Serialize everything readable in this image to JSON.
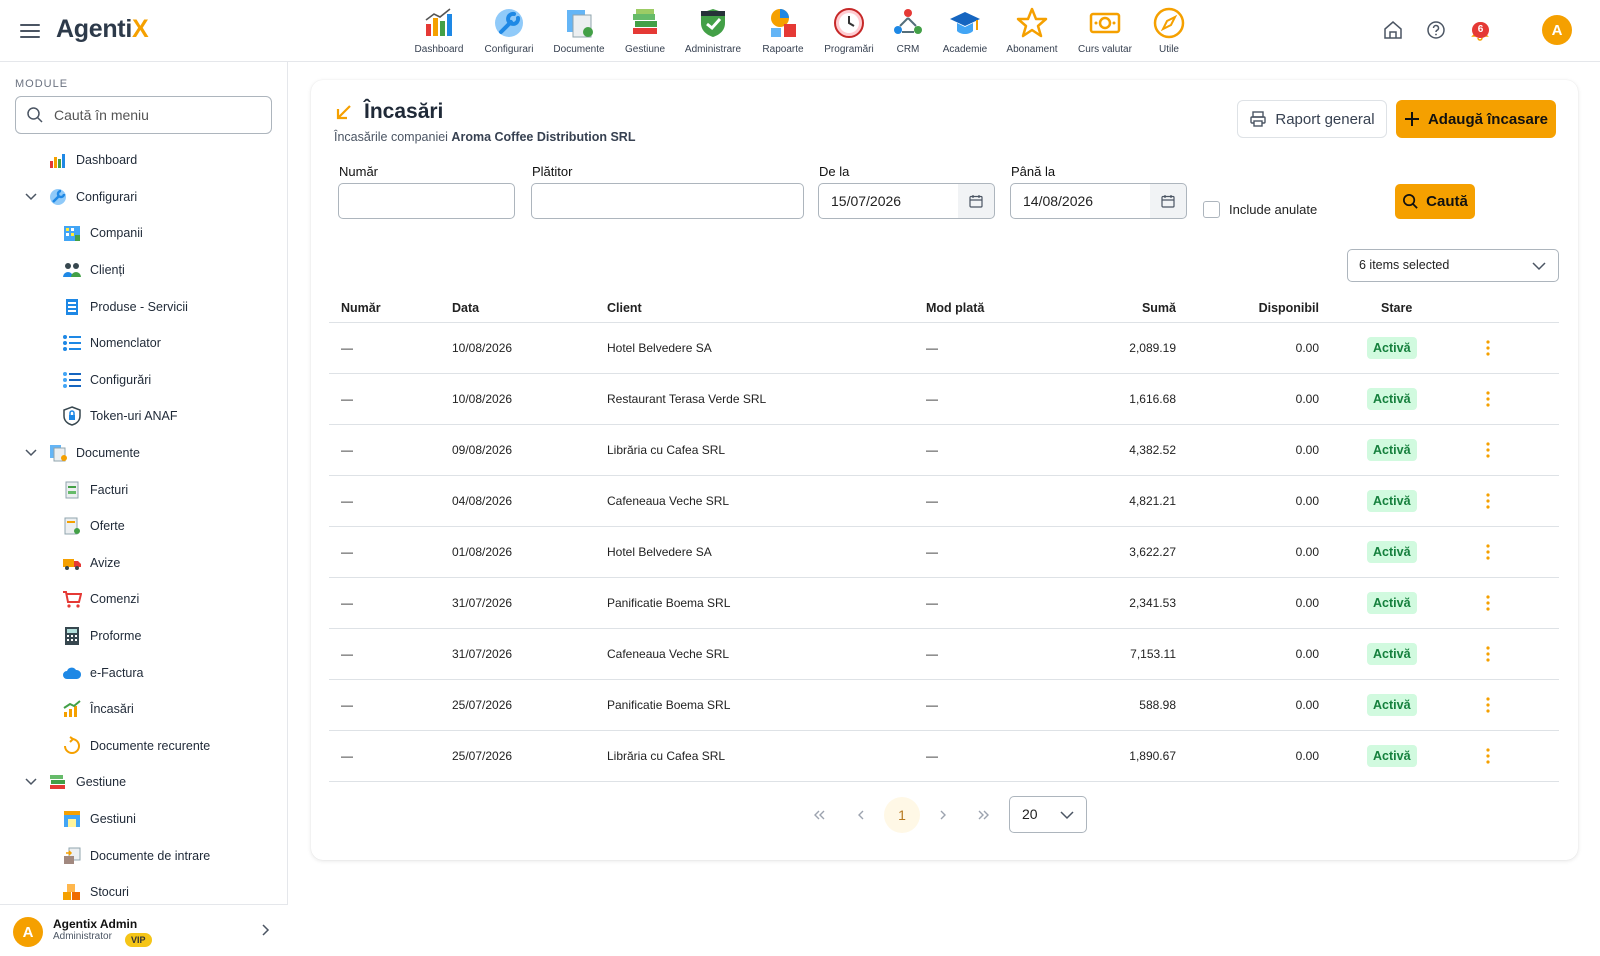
{
  "app": {
    "logo_main": "Agenti",
    "logo_accent": "X"
  },
  "topnav": [
    {
      "label": "Dashboard",
      "icon": "dashboard-chart-icon"
    },
    {
      "label": "Configurari",
      "icon": "wrench-icon"
    },
    {
      "label": "Documente",
      "icon": "documents-icon"
    },
    {
      "label": "Gestiune",
      "icon": "books-icon"
    },
    {
      "label": "Administrare",
      "icon": "shield-icon"
    },
    {
      "label": "Rapoarte",
      "icon": "report-icon"
    },
    {
      "label": "Programări",
      "icon": "clock-icon"
    },
    {
      "label": "CRM",
      "icon": "crm-icon"
    },
    {
      "label": "Academie",
      "icon": "graduation-cap-icon"
    },
    {
      "label": "Abonament",
      "icon": "star-icon"
    },
    {
      "label": "Curs valutar",
      "icon": "money-icon"
    },
    {
      "label": "Utile",
      "icon": "compass-icon"
    }
  ],
  "header": {
    "notifications_count": "6",
    "avatar_letter": "A"
  },
  "sidebar": {
    "section_title": "MODULE",
    "search_placeholder": "Caută în meniu",
    "items": [
      {
        "label": "Dashboard",
        "level": 0,
        "icon": "dashboard-chart-icon"
      },
      {
        "label": "Configurari",
        "level": 0,
        "icon": "wrench-icon",
        "expanded": true
      },
      {
        "label": "Companii",
        "level": 1,
        "icon": "building-icon"
      },
      {
        "label": "Clienți",
        "level": 1,
        "icon": "users-icon"
      },
      {
        "label": "Produse - Servicii",
        "level": 1,
        "icon": "product-list-icon"
      },
      {
        "label": "Nomenclator",
        "level": 1,
        "icon": "list-icon"
      },
      {
        "label": "Configurări",
        "level": 1,
        "icon": "settings-list-icon"
      },
      {
        "label": "Token-uri ANAF",
        "level": 1,
        "icon": "lock-shield-icon"
      },
      {
        "label": "Documente",
        "level": 0,
        "icon": "documents-icon",
        "expanded": true
      },
      {
        "label": "Facturi",
        "level": 1,
        "icon": "invoice-icon"
      },
      {
        "label": "Oferte",
        "level": 1,
        "icon": "offer-icon"
      },
      {
        "label": "Avize",
        "level": 1,
        "icon": "truck-icon"
      },
      {
        "label": "Comenzi",
        "level": 1,
        "icon": "cart-icon"
      },
      {
        "label": "Proforme",
        "level": 1,
        "icon": "calculator-icon"
      },
      {
        "label": "e-Factura",
        "level": 1,
        "icon": "cloud-icon"
      },
      {
        "label": "Încasări",
        "level": 1,
        "icon": "growth-chart-icon"
      },
      {
        "label": "Documente recurente",
        "level": 1,
        "icon": "recurring-icon"
      },
      {
        "label": "Gestiune",
        "level": 0,
        "icon": "books-icon",
        "expanded": true
      },
      {
        "label": "Gestiuni",
        "level": 1,
        "icon": "warehouse-icon"
      },
      {
        "label": "Documente de intrare",
        "level": 1,
        "icon": "inbound-docs-icon"
      },
      {
        "label": "Stocuri",
        "level": 1,
        "icon": "boxes-icon"
      }
    ],
    "user": {
      "avatar_letter": "A",
      "name": "Agentix Admin",
      "role": "Administrator",
      "badge": "VIP"
    }
  },
  "page": {
    "title": "Încasări",
    "subtitle_prefix": "Încasările companiei ",
    "company": "Aroma Coffee Distribution SRL",
    "raport_button": "Raport general",
    "add_button": "Adaugă încasare"
  },
  "filters": {
    "numar": {
      "label": "Număr",
      "value": ""
    },
    "platitor": {
      "label": "Plătitor",
      "value": ""
    },
    "de_la": {
      "label": "De la",
      "value": "15/07/2026"
    },
    "pana_la": {
      "label": "Până la",
      "value": "14/08/2026"
    },
    "include_anulate": {
      "label": "Include anulate",
      "checked": false
    },
    "search_button": "Caută",
    "columns_select": "6 items selected"
  },
  "table": {
    "headers": {
      "numar": "Număr",
      "data": "Data",
      "client": "Client",
      "mod_plata": "Mod plată",
      "suma": "Sumă",
      "disponibil": "Disponibil",
      "stare": "Stare"
    },
    "rows": [
      {
        "numar": "—",
        "data": "10/08/2026",
        "client": "Hotel Belvedere SA",
        "mod_plata": "—",
        "suma": "2,089.19",
        "disponibil": "0.00",
        "stare": "Activă"
      },
      {
        "numar": "—",
        "data": "10/08/2026",
        "client": "Restaurant Terasa Verde SRL",
        "mod_plata": "—",
        "suma": "1,616.68",
        "disponibil": "0.00",
        "stare": "Activă"
      },
      {
        "numar": "—",
        "data": "09/08/2026",
        "client": "Librăria cu Cafea SRL",
        "mod_plata": "—",
        "suma": "4,382.52",
        "disponibil": "0.00",
        "stare": "Activă"
      },
      {
        "numar": "—",
        "data": "04/08/2026",
        "client": "Cafeneaua Veche SRL",
        "mod_plata": "—",
        "suma": "4,821.21",
        "disponibil": "0.00",
        "stare": "Activă"
      },
      {
        "numar": "—",
        "data": "01/08/2026",
        "client": "Hotel Belvedere SA",
        "mod_plata": "—",
        "suma": "3,622.27",
        "disponibil": "0.00",
        "stare": "Activă"
      },
      {
        "numar": "—",
        "data": "31/07/2026",
        "client": "Panificatie Boema SRL",
        "mod_plata": "—",
        "suma": "2,341.53",
        "disponibil": "0.00",
        "stare": "Activă"
      },
      {
        "numar": "—",
        "data": "31/07/2026",
        "client": "Cafeneaua Veche SRL",
        "mod_plata": "—",
        "suma": "7,153.11",
        "disponibil": "0.00",
        "stare": "Activă"
      },
      {
        "numar": "—",
        "data": "25/07/2026",
        "client": "Panificatie Boema SRL",
        "mod_plata": "—",
        "suma": "588.98",
        "disponibil": "0.00",
        "stare": "Activă"
      },
      {
        "numar": "—",
        "data": "25/07/2026",
        "client": "Librăria cu Cafea SRL",
        "mod_plata": "—",
        "suma": "1,890.67",
        "disponibil": "0.00",
        "stare": "Activă"
      }
    ]
  },
  "pagination": {
    "current_page": "1",
    "page_size": "20"
  },
  "colors": {
    "accent": "#f5a000",
    "status_bg": "#d1fadf",
    "status_text": "#15803d",
    "badge": "#e53935"
  }
}
